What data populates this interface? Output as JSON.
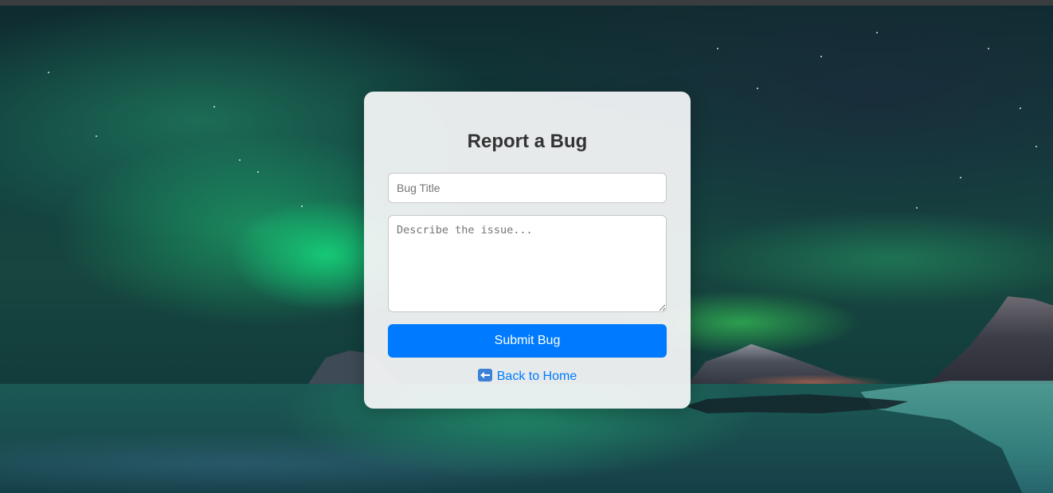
{
  "form": {
    "heading": "Report a Bug",
    "title_placeholder": "Bug Title",
    "title_value": "",
    "description_placeholder": "Describe the issue...",
    "description_value": "",
    "submit_label": "Submit Bug",
    "back_label": "Back to Home",
    "back_icon": "left-arrow-icon"
  },
  "colors": {
    "accent": "#007bff",
    "heading": "#333333",
    "card_background": "#f6f8f9"
  },
  "background": {
    "description_icon": "aurora-landscape-image"
  }
}
